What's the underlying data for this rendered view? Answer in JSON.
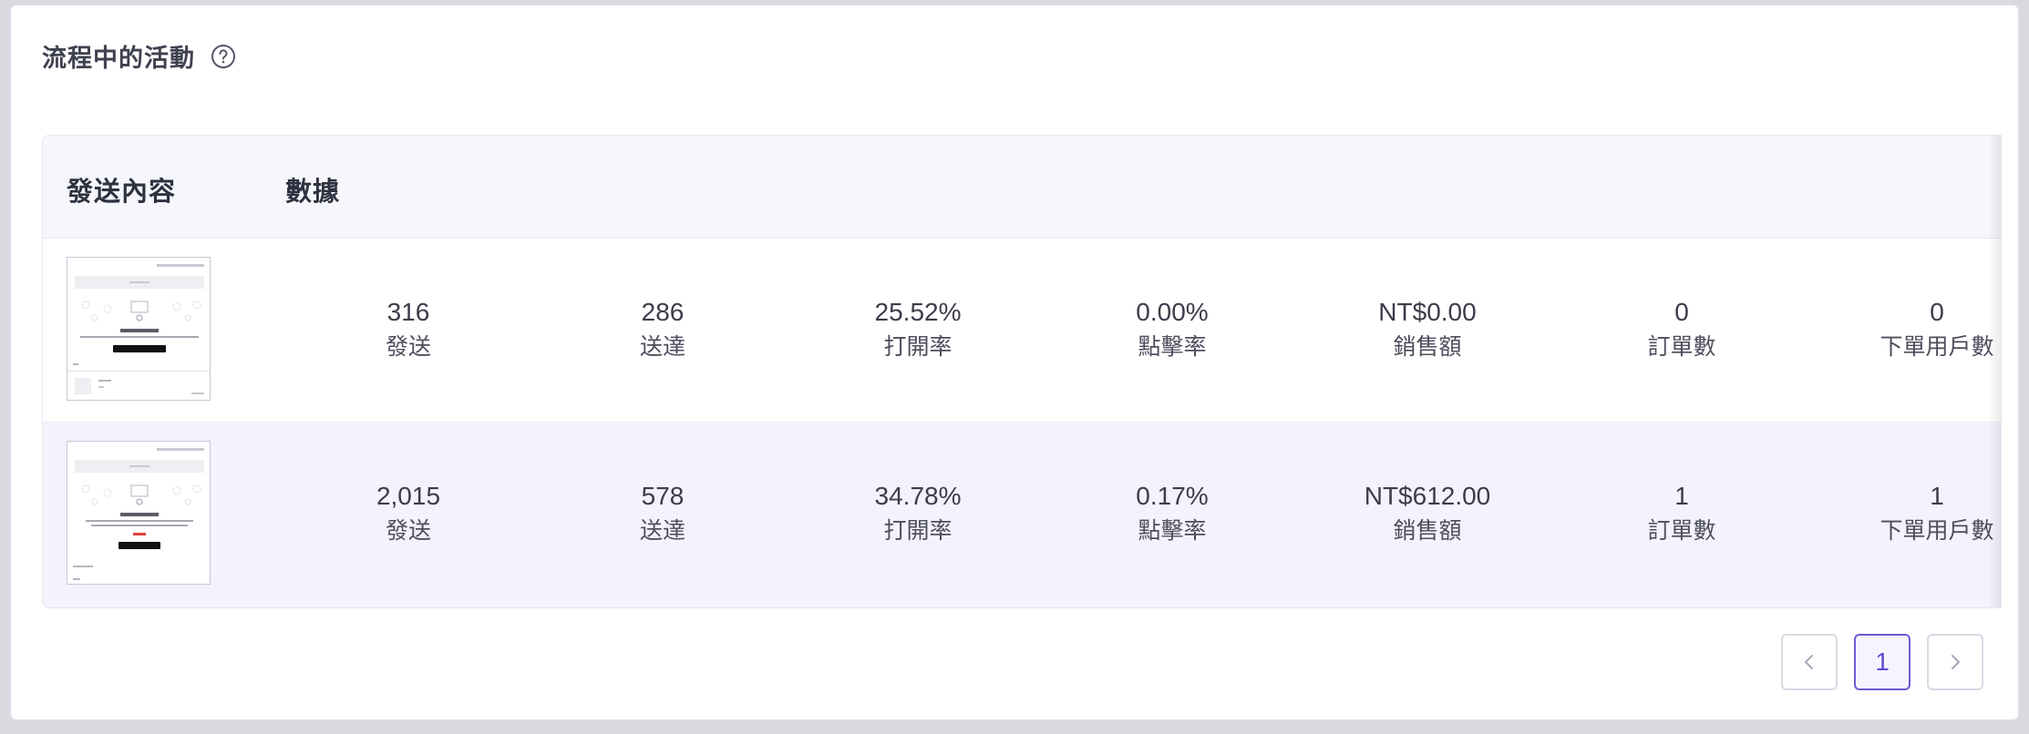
{
  "section": {
    "title": "流程中的活動",
    "help_icon": "question-circle-icon"
  },
  "table": {
    "headers": {
      "content": "發送內容",
      "stats": "數據"
    },
    "metric_labels": [
      "發送",
      "送達",
      "打開率",
      "點擊率",
      "銷售額",
      "訂單數",
      "下單用戶數"
    ],
    "rows": [
      {
        "values": [
          "316",
          "286",
          "25.52%",
          "0.00%",
          "NT$0.00",
          "0",
          "0"
        ]
      },
      {
        "values": [
          "2,015",
          "578",
          "34.78%",
          "0.17%",
          "NT$612.00",
          "1",
          "1"
        ]
      }
    ]
  },
  "pagination": {
    "prev_icon": "chevron-left-icon",
    "current_page": "1",
    "next_icon": "chevron-right-icon"
  },
  "colors": {
    "accent": "#5b4bd0",
    "header_bg": "#f5f7fc",
    "highlight_row_bg": "#f4f2fd"
  }
}
